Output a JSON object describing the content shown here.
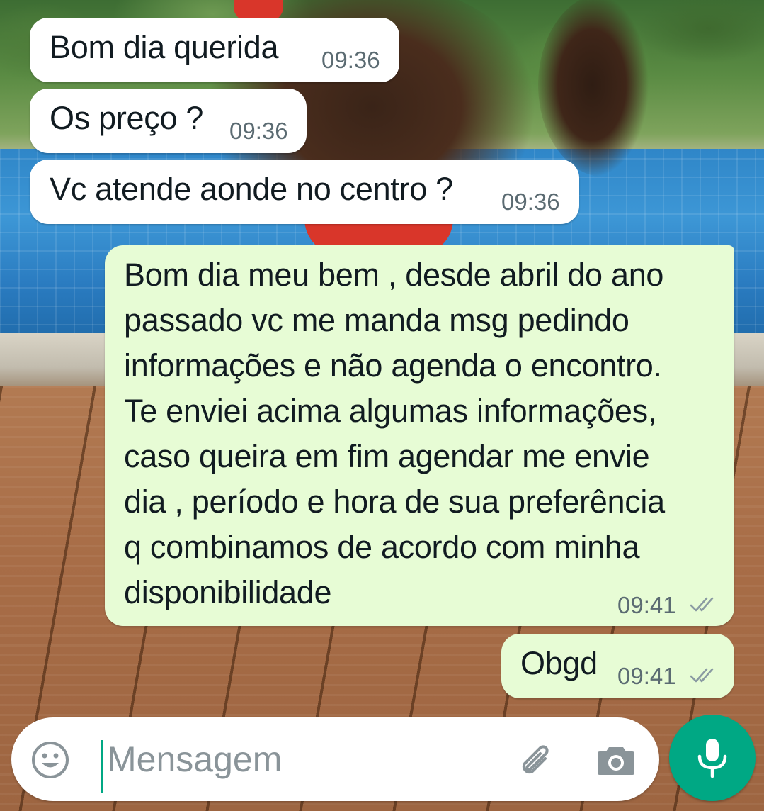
{
  "messages": [
    {
      "direction": "incoming",
      "text": "Bom dia querida",
      "time": "09:36"
    },
    {
      "direction": "incoming",
      "text": "Os preço ?",
      "time": "09:36"
    },
    {
      "direction": "incoming",
      "text": "Vc atende aonde no centro ?",
      "time": "09:36"
    },
    {
      "direction": "outgoing",
      "text": "Bom dia meu bem , desde abril do ano\npassado vc me manda msg pedindo\ninformações e não agenda o encontro.\nTe enviei acima algumas informações,\ncaso queira em fim agendar me envie\ndia , período e hora de sua preferência\nq combinamos de acordo com minha\ndisponibilidade",
      "time": "09:41",
      "status": "read"
    },
    {
      "direction": "outgoing",
      "text": "Obgd",
      "time": "09:41",
      "status": "read"
    }
  ],
  "composer": {
    "placeholder": "Mensagem",
    "emoji_icon": "emoji-icon",
    "attach_icon": "paperclip-icon",
    "camera_icon": "camera-icon",
    "mic_icon": "microphone-icon"
  },
  "colors": {
    "incoming_bubble": "#ffffff",
    "outgoing_bubble": "#e7fcd5",
    "accent": "#00a884",
    "timestamp": "#5b6b72",
    "text": "#111b21"
  }
}
